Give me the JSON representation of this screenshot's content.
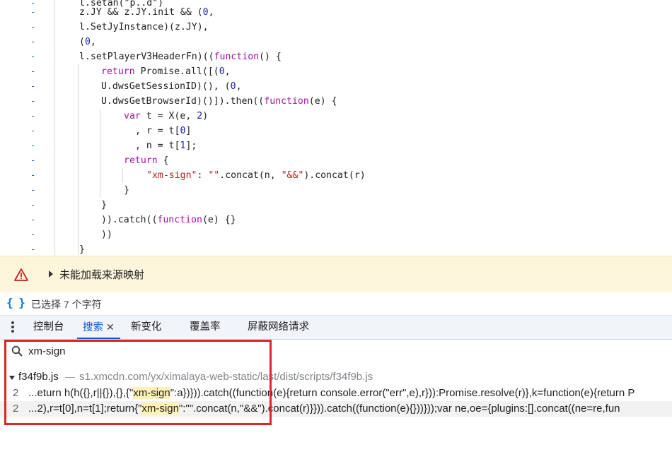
{
  "code": {
    "lines": [
      {
        "mark": "-",
        "html_parts": [
          [
            "plain",
            "l.setan(\"p..d\")"
          ]
        ]
      },
      {
        "mark": "-",
        "parts": [
          [
            "plain",
            "z.JY && z.JY.init && ("
          ],
          [
            "num",
            "0"
          ],
          [
            "plain",
            ","
          ]
        ]
      },
      {
        "mark": "-",
        "parts": [
          [
            "plain",
            "l.SetJyInstance)(z.JY),"
          ]
        ]
      },
      {
        "mark": "-",
        "parts": [
          [
            "plain",
            "("
          ],
          [
            "num",
            "0"
          ],
          [
            "plain",
            ","
          ]
        ]
      },
      {
        "mark": "-",
        "parts": [
          [
            "plain",
            "l.setPlayerV3HeaderFn)(("
          ],
          [
            "kw",
            "function"
          ],
          [
            "plain",
            "() {"
          ]
        ]
      },
      {
        "mark": "-",
        "parts": [
          [
            "kw",
            "return"
          ],
          [
            "plain",
            " Promise.all([("
          ],
          [
            "num",
            "0"
          ],
          [
            "plain",
            ","
          ]
        ]
      },
      {
        "mark": "-",
        "parts": [
          [
            "plain",
            "U.dwsGetSessionID)(), ("
          ],
          [
            "num",
            "0"
          ],
          [
            "plain",
            ","
          ]
        ]
      },
      {
        "mark": "-",
        "parts": [
          [
            "plain",
            "U.dwsGetBrowserId)()]).then(("
          ],
          [
            "kw",
            "function"
          ],
          [
            "plain",
            "(e) {"
          ]
        ]
      },
      {
        "mark": "-",
        "parts": [
          [
            "kw",
            "var"
          ],
          [
            "plain",
            " t = X(e, "
          ],
          [
            "num",
            "2"
          ],
          [
            "plain",
            ")"
          ]
        ]
      },
      {
        "mark": "-",
        "parts": [
          [
            "plain",
            ", r = t["
          ],
          [
            "num",
            "0"
          ],
          [
            "plain",
            "]"
          ]
        ]
      },
      {
        "mark": "-",
        "parts": [
          [
            "plain",
            ", n = t["
          ],
          [
            "num",
            "1"
          ],
          [
            "plain",
            "];"
          ]
        ]
      },
      {
        "mark": "-",
        "parts": [
          [
            "kw",
            "return"
          ],
          [
            "plain",
            " {"
          ]
        ]
      },
      {
        "mark": "-",
        "parts": [
          [
            "str",
            "\"xm-sign\""
          ],
          [
            "plain",
            ": "
          ],
          [
            "str",
            "\"\""
          ],
          [
            "plain",
            ".concat(n, "
          ],
          [
            "str",
            "\"&&\""
          ],
          [
            "plain",
            ").concat(r)"
          ]
        ]
      },
      {
        "mark": "-",
        "parts": [
          [
            "plain",
            "}"
          ]
        ]
      },
      {
        "mark": "-",
        "parts": [
          [
            "plain",
            "}"
          ]
        ]
      },
      {
        "mark": "-",
        "parts": [
          [
            "plain",
            ")).catch(("
          ],
          [
            "kw",
            "function"
          ],
          [
            "plain",
            "(e) {}"
          ]
        ]
      },
      {
        "mark": "-",
        "parts": [
          [
            "plain",
            "))"
          ]
        ]
      },
      {
        "mark": "-",
        "parts": [
          [
            "plain",
            "}"
          ]
        ]
      }
    ]
  },
  "warning": {
    "icon": "warning-icon",
    "text": "未能加载来源映射"
  },
  "status": {
    "icon": "curly-braces-icon",
    "text": "已选择 7 个字符"
  },
  "drawer": {
    "menu_icon": "more-vertical-icon",
    "tabs": [
      {
        "label": "控制台",
        "active": false
      },
      {
        "label": "搜索",
        "active": true
      },
      {
        "label": "新变化",
        "active": false
      },
      {
        "label": "覆盖率",
        "active": false
      },
      {
        "label": "屏蔽网络请求",
        "active": false
      }
    ],
    "close_glyph": "✕"
  },
  "search": {
    "icon": "search-icon",
    "value": "xm-sign"
  },
  "results": {
    "file": {
      "name": "f34f9b.js",
      "separator": "—",
      "path": "s1.xmcdn.com/yx/ximalaya-web-static/last/dist/scripts/f34f9b.js"
    },
    "matches": [
      {
        "line": "2",
        "before": "...eturn h(h({},r||{}),{},{\"",
        "highlight": "xm-sign",
        "after": "\":a})})).catch((function(e){return console.error(\"err\",e),r})):Promise.resolve(r)},k=function(e){return P"
      },
      {
        "line": "2",
        "before": "...2),r=t[0],n=t[1];return{\"",
        "highlight": "xm-sign",
        "after": "\":\"\".concat(n,\"&&\").concat(r)}})).catch((function(e){}))}));var ne,oe={plugins:[].concat((ne=re,fun"
      }
    ]
  },
  "colors": {
    "accent": "#0b57d0",
    "warning_bg": "#fdf6dc",
    "highlight": "#fdf2b3",
    "annotation": "#e02424"
  }
}
